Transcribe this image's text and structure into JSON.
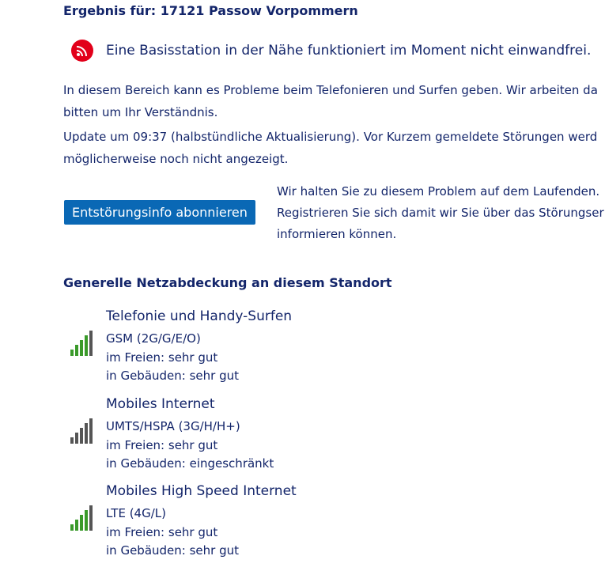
{
  "result": {
    "title": "Ergebnis für: 17121 Passow Vorpommern"
  },
  "alert": {
    "icon": "outage-signal-icon",
    "text": "Eine Basisstation in der Nähe funktioniert im Moment nicht einwandfrei."
  },
  "description": {
    "line1": "In diesem Bereich kann es Probleme beim Telefonieren und Surfen geben. Wir arbeiten da",
    "line2": "bitten um Ihr Verständnis.",
    "line3": "Update um 09:37 (halbstündliche Aktualisierung). Vor Kurzem gemeldete Störungen werd",
    "line4": "möglicherweise noch nicht angezeigt."
  },
  "subscribe": {
    "button_label": "Entstörungsinfo abonnieren",
    "info_line1": "Wir halten Sie zu diesem Problem auf dem Laufenden.",
    "info_line2": "Registrieren Sie sich damit wir Sie über das Störungser",
    "info_line3": "informieren können."
  },
  "coverage": {
    "title": "Generelle Netzabdeckung an diesem Standort",
    "colors": {
      "active_bar": "#3a9a2a",
      "inactive_bar": "#555555"
    },
    "items": [
      {
        "title": "Telefonie und Handy-Surfen",
        "tech": "GSM (2G/G/E/O)",
        "outdoor": "im Freien: sehr gut",
        "indoor": "in Gebäuden: sehr gut",
        "bars_active": 4,
        "bars_total": 5
      },
      {
        "title": "Mobiles Internet",
        "tech": "UMTS/HSPA (3G/H/H+)",
        "outdoor": "im Freien: sehr gut",
        "indoor": "in Gebäuden: eingeschränkt",
        "bars_active": 0,
        "bars_total": 5
      },
      {
        "title": "Mobiles High Speed Internet",
        "tech": "LTE (4G/L)",
        "outdoor": "im Freien: sehr gut",
        "indoor": "in Gebäuden: sehr gut",
        "bars_active": 4,
        "bars_total": 5
      }
    ]
  }
}
